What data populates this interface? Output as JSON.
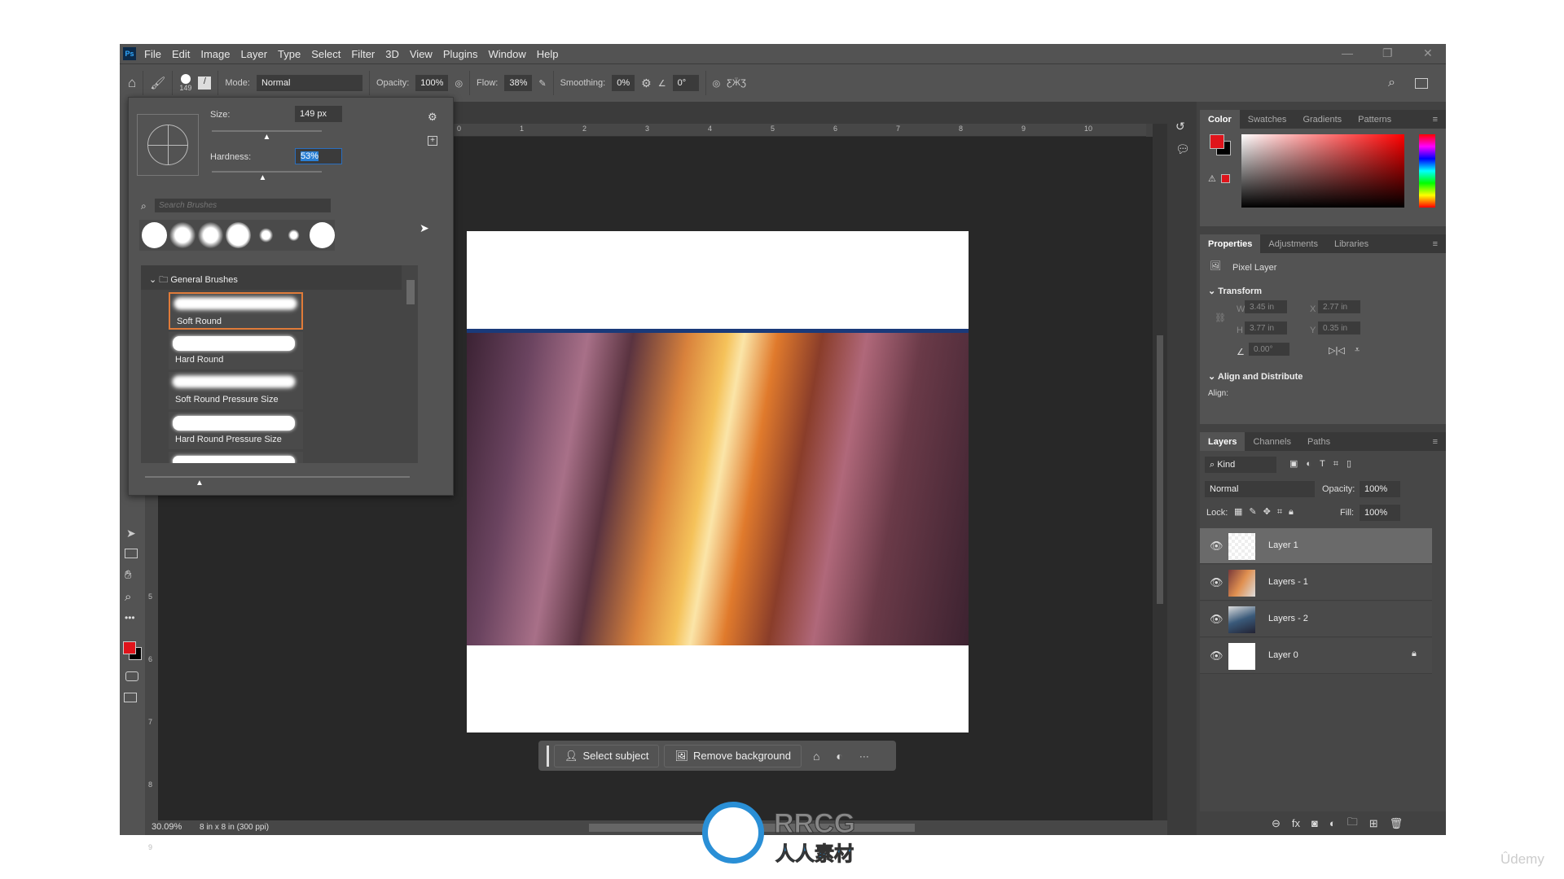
{
  "menu": {
    "logo": "Ps",
    "items": [
      "File",
      "Edit",
      "Image",
      "Layer",
      "Type",
      "Select",
      "Filter",
      "3D",
      "View",
      "Plugins",
      "Window",
      "Help"
    ]
  },
  "window_controls": {
    "minimize": "—",
    "restore": "❐",
    "close": "✕"
  },
  "options": {
    "brush_size": "149",
    "mode_label": "Mode:",
    "mode_value": "Normal",
    "opacity_label": "Opacity:",
    "opacity_value": "100%",
    "flow_label": "Flow:",
    "flow_value": "38%",
    "smoothing_label": "Smoothing:",
    "smoothing_value": "0%",
    "angle_value": "0°"
  },
  "ruler": {
    "top": [
      "0",
      "1",
      "2",
      "3",
      "4",
      "5",
      "6",
      "7",
      "8",
      "9",
      "10"
    ],
    "left": [
      "5",
      "6",
      "7",
      "8",
      "9"
    ]
  },
  "brush_popup": {
    "size_label": "Size:",
    "size_value": "149 px",
    "size_fraction": 0.5,
    "hardness_label": "Hardness:",
    "hardness_value": "53%",
    "hardness_fraction": 0.53,
    "search_placeholder": "Search Brushes",
    "folder": "General Brushes",
    "brushes": [
      "Soft Round",
      "Hard Round",
      "Soft Round Pressure Size",
      "Hard Round Pressure Size"
    ],
    "selected": "Soft Round"
  },
  "context_bar": {
    "select_subject": "Select subject",
    "remove_background": "Remove background",
    "more": "···"
  },
  "status": {
    "zoom": "30.09%",
    "doc_info": "8 in x 8 in (300 ppi)"
  },
  "color_panel": {
    "tabs": [
      "Color",
      "Swatches",
      "Gradients",
      "Patterns"
    ],
    "foreground": "#e0141b",
    "background": "#000000"
  },
  "properties": {
    "tabs": [
      "Properties",
      "Adjustments",
      "Libraries"
    ],
    "layer_type": "Pixel Layer",
    "transform_label": "Transform",
    "w": "3.45 in",
    "x": "2.77 in",
    "h": "3.77 in",
    "y": "0.35 in",
    "angle": "0.00°",
    "align_label": "Align and Distribute",
    "align": "Align:",
    "w_label": "W",
    "h_label": "H",
    "x_label": "X",
    "y_label": "Y"
  },
  "layers": {
    "tabs": [
      "Layers",
      "Channels",
      "Paths"
    ],
    "kind": "Kind",
    "blend": "Normal",
    "opacity_label": "Opacity:",
    "opacity": "100%",
    "lock_label": "Lock:",
    "fill_label": "Fill:",
    "fill": "100%",
    "items": [
      {
        "name": "Layer 1",
        "selected": true
      },
      {
        "name": "Layers - 1"
      },
      {
        "name": "Layers - 2"
      },
      {
        "name": "Layer 0",
        "locked": true
      }
    ]
  },
  "watermark": {
    "text": "RRCG",
    "subtext": "人人素材"
  },
  "udemy": "Ûdemy"
}
